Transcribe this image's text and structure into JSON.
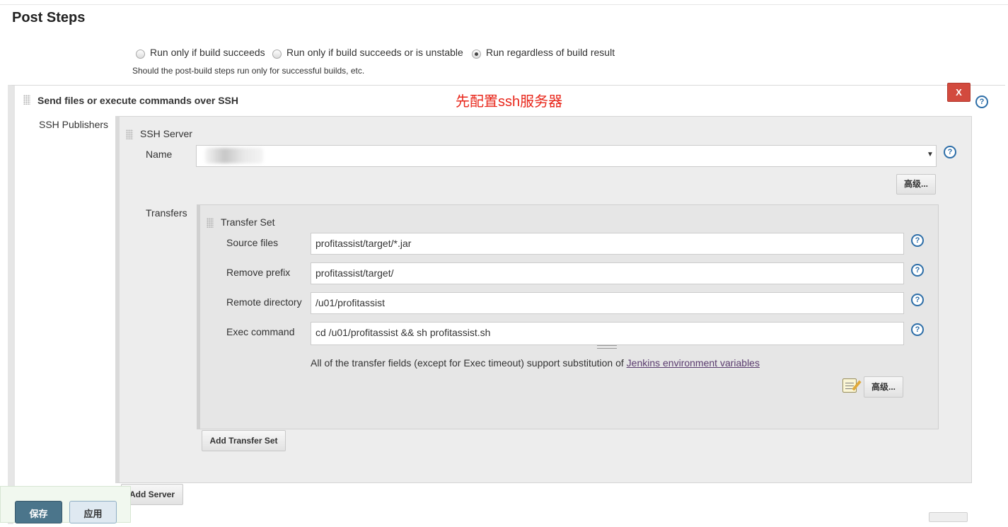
{
  "section_title": "Post Steps",
  "post_steps": {
    "options": [
      {
        "label": "Run only if build succeeds",
        "checked": false
      },
      {
        "label": "Run only if build succeeds or is unstable",
        "checked": false
      },
      {
        "label": "Run regardless of build result",
        "checked": true
      }
    ],
    "hint": "Should the post-build steps run only for successful builds, etc."
  },
  "ssh_step": {
    "title": "Send files or execute commands over SSH",
    "delete_label": "X",
    "annotation": "先配置ssh服务器",
    "annotation_color": "#e8261a",
    "publishers_label": "SSH Publishers",
    "server": {
      "title": "SSH Server",
      "name_label": "Name",
      "name_value": "",
      "advanced_label": "高级..."
    },
    "transfers_label": "Transfers",
    "transfer_set": {
      "title": "Transfer Set",
      "fields": {
        "source_label": "Source files",
        "source_value": "profitassist/target/*.jar",
        "prefix_label": "Remove prefix",
        "prefix_value": "profitassist/target/",
        "remote_label": "Remote directory",
        "remote_value": "/u01/profitassist",
        "exec_label": "Exec command",
        "exec_value": "cd /u01/profitassist && sh profitassist.sh"
      },
      "note_prefix": "All of the transfer fields (except for Exec timeout) support substitution of ",
      "note_link": "Jenkins environment variables",
      "advanced_label": "高级..."
    },
    "add_transfer_label": "Add Transfer Set",
    "add_server_label": "Add Server"
  },
  "footer": {
    "save_label": "保存",
    "apply_label": "应用"
  },
  "colors": {
    "danger": "#d24a3e",
    "help": "#2d6ea8",
    "save": "#4b758b"
  }
}
